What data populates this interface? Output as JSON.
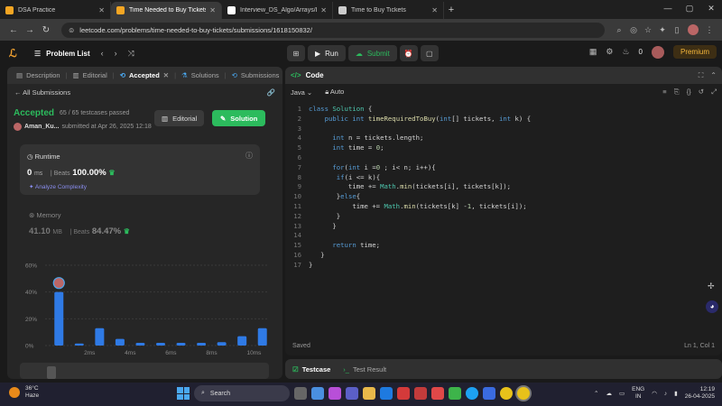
{
  "browser": {
    "tabs": [
      {
        "title": "DSA Practice",
        "color": "#f5a623",
        "active": false
      },
      {
        "title": "Time Needed to Buy Tickets - L",
        "color": "#f5a623",
        "active": true
      },
      {
        "title": "Interview_DS_Algo/Arrays/Leet",
        "color": "#ffffff",
        "active": false
      },
      {
        "title": "Time to Buy Tickets",
        "color": "#cccccc",
        "active": false
      }
    ],
    "url": "leetcode.com/problems/time-needed-to-buy-tickets/submissions/1618150832/"
  },
  "header": {
    "problem_list": "Problem List",
    "run": "Run",
    "submit": "Submit",
    "streak": "0",
    "premium": "Premium"
  },
  "left": {
    "tabs": [
      "Description",
      "Editorial",
      "Accepted",
      "Solutions",
      "Submissions"
    ],
    "all_submissions": "All Submissions",
    "status": "Accepted",
    "passed": "65 / 65 testcases passed",
    "user": "Aman_Ku...",
    "submitted": "submitted at Apr 26, 2025 12:18",
    "editorial_btn": "Editorial",
    "solution_btn": "Solution",
    "runtime": {
      "label": "Runtime",
      "value": "0",
      "unit": "ms",
      "beats": "Beats",
      "pct": "100.00%",
      "analyze": "Analyze Complexity"
    },
    "memory": {
      "label": "Memory",
      "value": "41.10",
      "unit": "MB",
      "beats": "Beats",
      "pct": "84.47%"
    }
  },
  "chart_data": {
    "type": "bar",
    "ylabels": [
      "60%",
      "40%",
      "20%",
      "0%"
    ],
    "xlabels": [
      "2ms",
      "4ms",
      "6ms",
      "8ms",
      "10ms"
    ],
    "values": [
      40,
      1.5,
      13,
      5,
      2,
      2,
      2,
      2,
      2.5,
      7,
      13
    ],
    "ylim": [
      0,
      60
    ],
    "color": "#2f7ae5"
  },
  "editor": {
    "title": "Code",
    "language": "Java",
    "auto": "Auto",
    "saved": "Saved",
    "position": "Ln 1, Col 1"
  },
  "bottom": {
    "testcase": "Testcase",
    "test_result": "Test Result"
  },
  "taskbar": {
    "temp": "36°C",
    "weather": "Haze",
    "search": "Search",
    "lang1": "ENG",
    "lang2": "IN",
    "time": "12:19",
    "date": "26-04-2025"
  }
}
